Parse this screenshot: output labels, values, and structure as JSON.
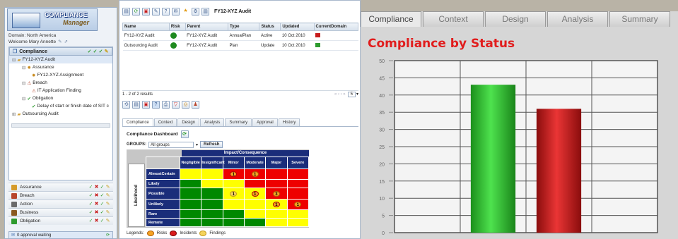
{
  "logo": {
    "title": "COMPLIANCE",
    "subtitle": "Manager"
  },
  "user": {
    "domain": "Domain: North America",
    "welcome": "Welcome Mary Annette"
  },
  "tree_panel": {
    "title": "Compliance"
  },
  "tree": [
    {
      "label": "FY12-XYZ Audit",
      "level": 1,
      "icon": "folder-icon"
    },
    {
      "label": "Assurance",
      "level": 2,
      "icon": "assurance-icon"
    },
    {
      "label": "FY12-XYZ Assignment",
      "level": 3,
      "icon": "assignment-icon"
    },
    {
      "label": "Breach",
      "level": 2,
      "icon": "breach-icon"
    },
    {
      "label": "IT Application Finding",
      "level": 3,
      "icon": "finding-icon"
    },
    {
      "label": "Obligation",
      "level": 2,
      "icon": "obligation-icon"
    },
    {
      "label": "Delay of start or finish date of SIT c",
      "level": 3,
      "icon": "check-icon"
    },
    {
      "label": "Outsourcing Audit",
      "level": 1,
      "icon": "folder-icon"
    }
  ],
  "accordion": [
    {
      "label": "Assurance",
      "color": "#d59b2b"
    },
    {
      "label": "Breach",
      "color": "#b8452b"
    },
    {
      "label": "Action",
      "color": "#6a6a6a"
    },
    {
      "label": "Business",
      "color": "#8a5a20"
    },
    {
      "label": "Obligation",
      "color": "#2e9b2e"
    }
  ],
  "approval": {
    "label": "0 approval waiting"
  },
  "record": {
    "title": "FY12-XYZ Audit"
  },
  "grid": {
    "columns": [
      "Name",
      "Risk",
      "Parent",
      "Type",
      "Status",
      "Updated",
      "CurrentDomain"
    ],
    "rows": [
      {
        "name": "FY12-XYZ Audit",
        "parent": "FY12-XYZ Audit",
        "type": "AnnualPlan",
        "status": "Active",
        "updated": "10 Oct 2010"
      },
      {
        "name": "Outsourcing Audit",
        "parent": "FY12-XYZ Audit",
        "type": "Plan",
        "status": "Update",
        "updated": "10 Oct 2010"
      }
    ],
    "results": "1 - 2 of 2 results",
    "page_size": "5"
  },
  "detail_tabs": [
    "Compliance",
    "Context",
    "Design",
    "Analysis",
    "Summary",
    "Approval",
    "History"
  ],
  "dashboard": {
    "title": "Compliance Dashboard",
    "groups_label": "GROUPS:",
    "groups_value": "All groups",
    "refresh": "Refresh",
    "matrix_title": "Impact/Consequence",
    "y_axis": "Likelihood",
    "impact": [
      "Negligible",
      "Insignificant",
      "Minor",
      "Moderate",
      "Major",
      "Severe"
    ],
    "likelihood": [
      "AlmostCertain",
      "Likely",
      "Possible",
      "Unlikely",
      "Rare",
      "Remote"
    ],
    "matrix": [
      [
        "Y",
        "Y",
        "R",
        "R",
        "R",
        "R"
      ],
      [
        "G",
        "Y",
        "Y",
        "R",
        "R",
        "R"
      ],
      [
        "G",
        "G",
        "Y",
        "Y",
        "R",
        "R"
      ],
      [
        "G",
        "G",
        "Y",
        "Y",
        "Y",
        "R"
      ],
      [
        "G",
        "G",
        "G",
        "Y",
        "Y",
        "Y"
      ],
      [
        "G",
        "G",
        "G",
        "G",
        "Y",
        "Y"
      ]
    ],
    "markers": [
      {
        "row": 0,
        "col": 2,
        "kind": "incident",
        "count": "1"
      },
      {
        "row": 0,
        "col": 3,
        "kind": "risk",
        "count": "1"
      },
      {
        "row": 2,
        "col": 2,
        "kind": "finding",
        "count": "1"
      },
      {
        "row": 2,
        "col": 3,
        "kind": "incident",
        "count": "1"
      },
      {
        "row": 2,
        "col": 4,
        "kind": "risk",
        "count": "3"
      },
      {
        "row": 3,
        "col": 4,
        "kind": "incident",
        "count": "1"
      },
      {
        "row": 3,
        "col": 5,
        "kind": "risk",
        "count": "1"
      }
    ],
    "legend": [
      "Legends:",
      "Risks",
      "Incidents",
      "Findings"
    ]
  },
  "right_tabs": [
    "Compliance",
    "Context",
    "Design",
    "Analysis",
    "Summary"
  ],
  "chart_data": {
    "type": "bar",
    "title": "Compliance by Status",
    "categories": [
      "",
      "",
      "",
      ""
    ],
    "values": [
      null,
      43,
      36,
      null
    ],
    "colors": [
      null,
      "#2fbf2f",
      "#c81e1e",
      null
    ],
    "ylim": [
      0,
      50
    ],
    "yticks": [
      0,
      5,
      10,
      15,
      20,
      25,
      30,
      35,
      40,
      45,
      50
    ],
    "grid": true
  }
}
